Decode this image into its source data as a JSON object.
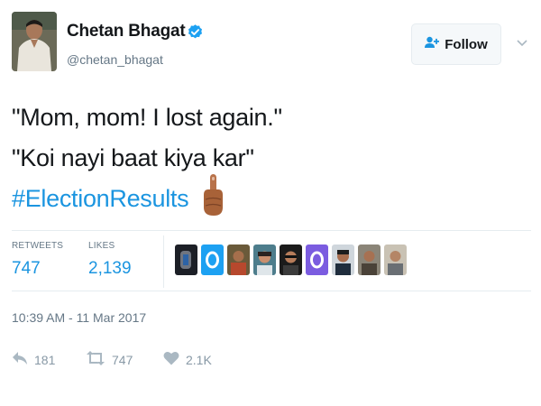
{
  "author": {
    "name": "Chetan Bhagat",
    "handle": "@chetan_bhagat",
    "verified": true
  },
  "follow_button": {
    "label": "Follow",
    "icon": "add-user-icon"
  },
  "tweet": {
    "lines": [
      "\"Mom, mom! I lost again.\"",
      "\"Koi nayi baat kiya kar\"",
      "#ElectionResults"
    ],
    "emoji": "middle-finger-emoji"
  },
  "stats": {
    "retweets_label": "RETWEETS",
    "retweets_value": "747",
    "likes_label": "LIKES",
    "likes_value": "2,139"
  },
  "liked_by_count_shown": 9,
  "timestamp": "10:39 AM - 11 Mar 2017",
  "actions": {
    "reply_count": "181",
    "retweet_count": "747",
    "like_count": "2.1K"
  },
  "colors": {
    "link": "#1b95e0",
    "verified": "#1da1f2",
    "muted": "#657786",
    "action_icon": "#aab8c2",
    "default_avatar": "#1da1f2"
  }
}
